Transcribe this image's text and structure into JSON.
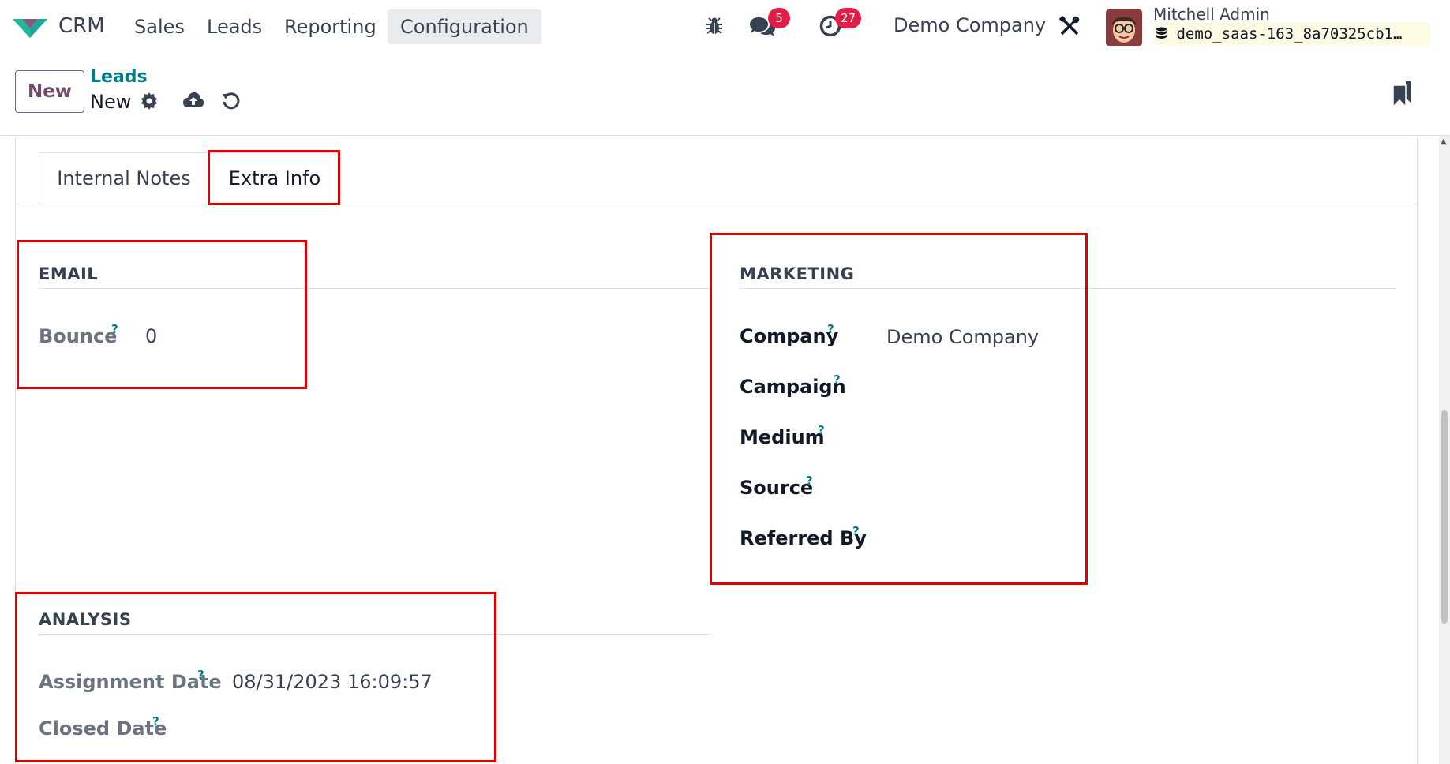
{
  "navbar": {
    "app_name": "CRM",
    "menu": [
      "Sales",
      "Leads",
      "Reporting",
      "Configuration"
    ],
    "active_menu": "Configuration",
    "messages_count": "5",
    "activities_count": "27",
    "company": "Demo Company",
    "user_name": "Mitchell Admin",
    "database": "demo_saas-163_8a70325cb1…"
  },
  "control_panel": {
    "new_label": "New",
    "breadcrumb_parent": "Leads",
    "breadcrumb_current": "New"
  },
  "tabs": {
    "internal_notes": "Internal Notes",
    "extra_info": "Extra Info",
    "active": "Extra Info"
  },
  "email": {
    "title": "EMAIL",
    "bounce_label": "Bounce",
    "bounce_value": "0"
  },
  "marketing": {
    "title": "MARKETING",
    "company_label": "Company",
    "company_value": "Demo Company",
    "campaign_label": "Campaign",
    "medium_label": "Medium",
    "source_label": "Source",
    "referred_label": "Referred By"
  },
  "analysis": {
    "title": "ANALYSIS",
    "assignment_label": "Assignment Date",
    "assignment_value": "08/31/2023 16:09:57",
    "closed_label": "Closed Date"
  },
  "help_mark": "?",
  "colors": {
    "brand": "#714b67",
    "link_teal": "#017e84",
    "badge_red": "#e11d48",
    "highlight": "#e00000"
  }
}
